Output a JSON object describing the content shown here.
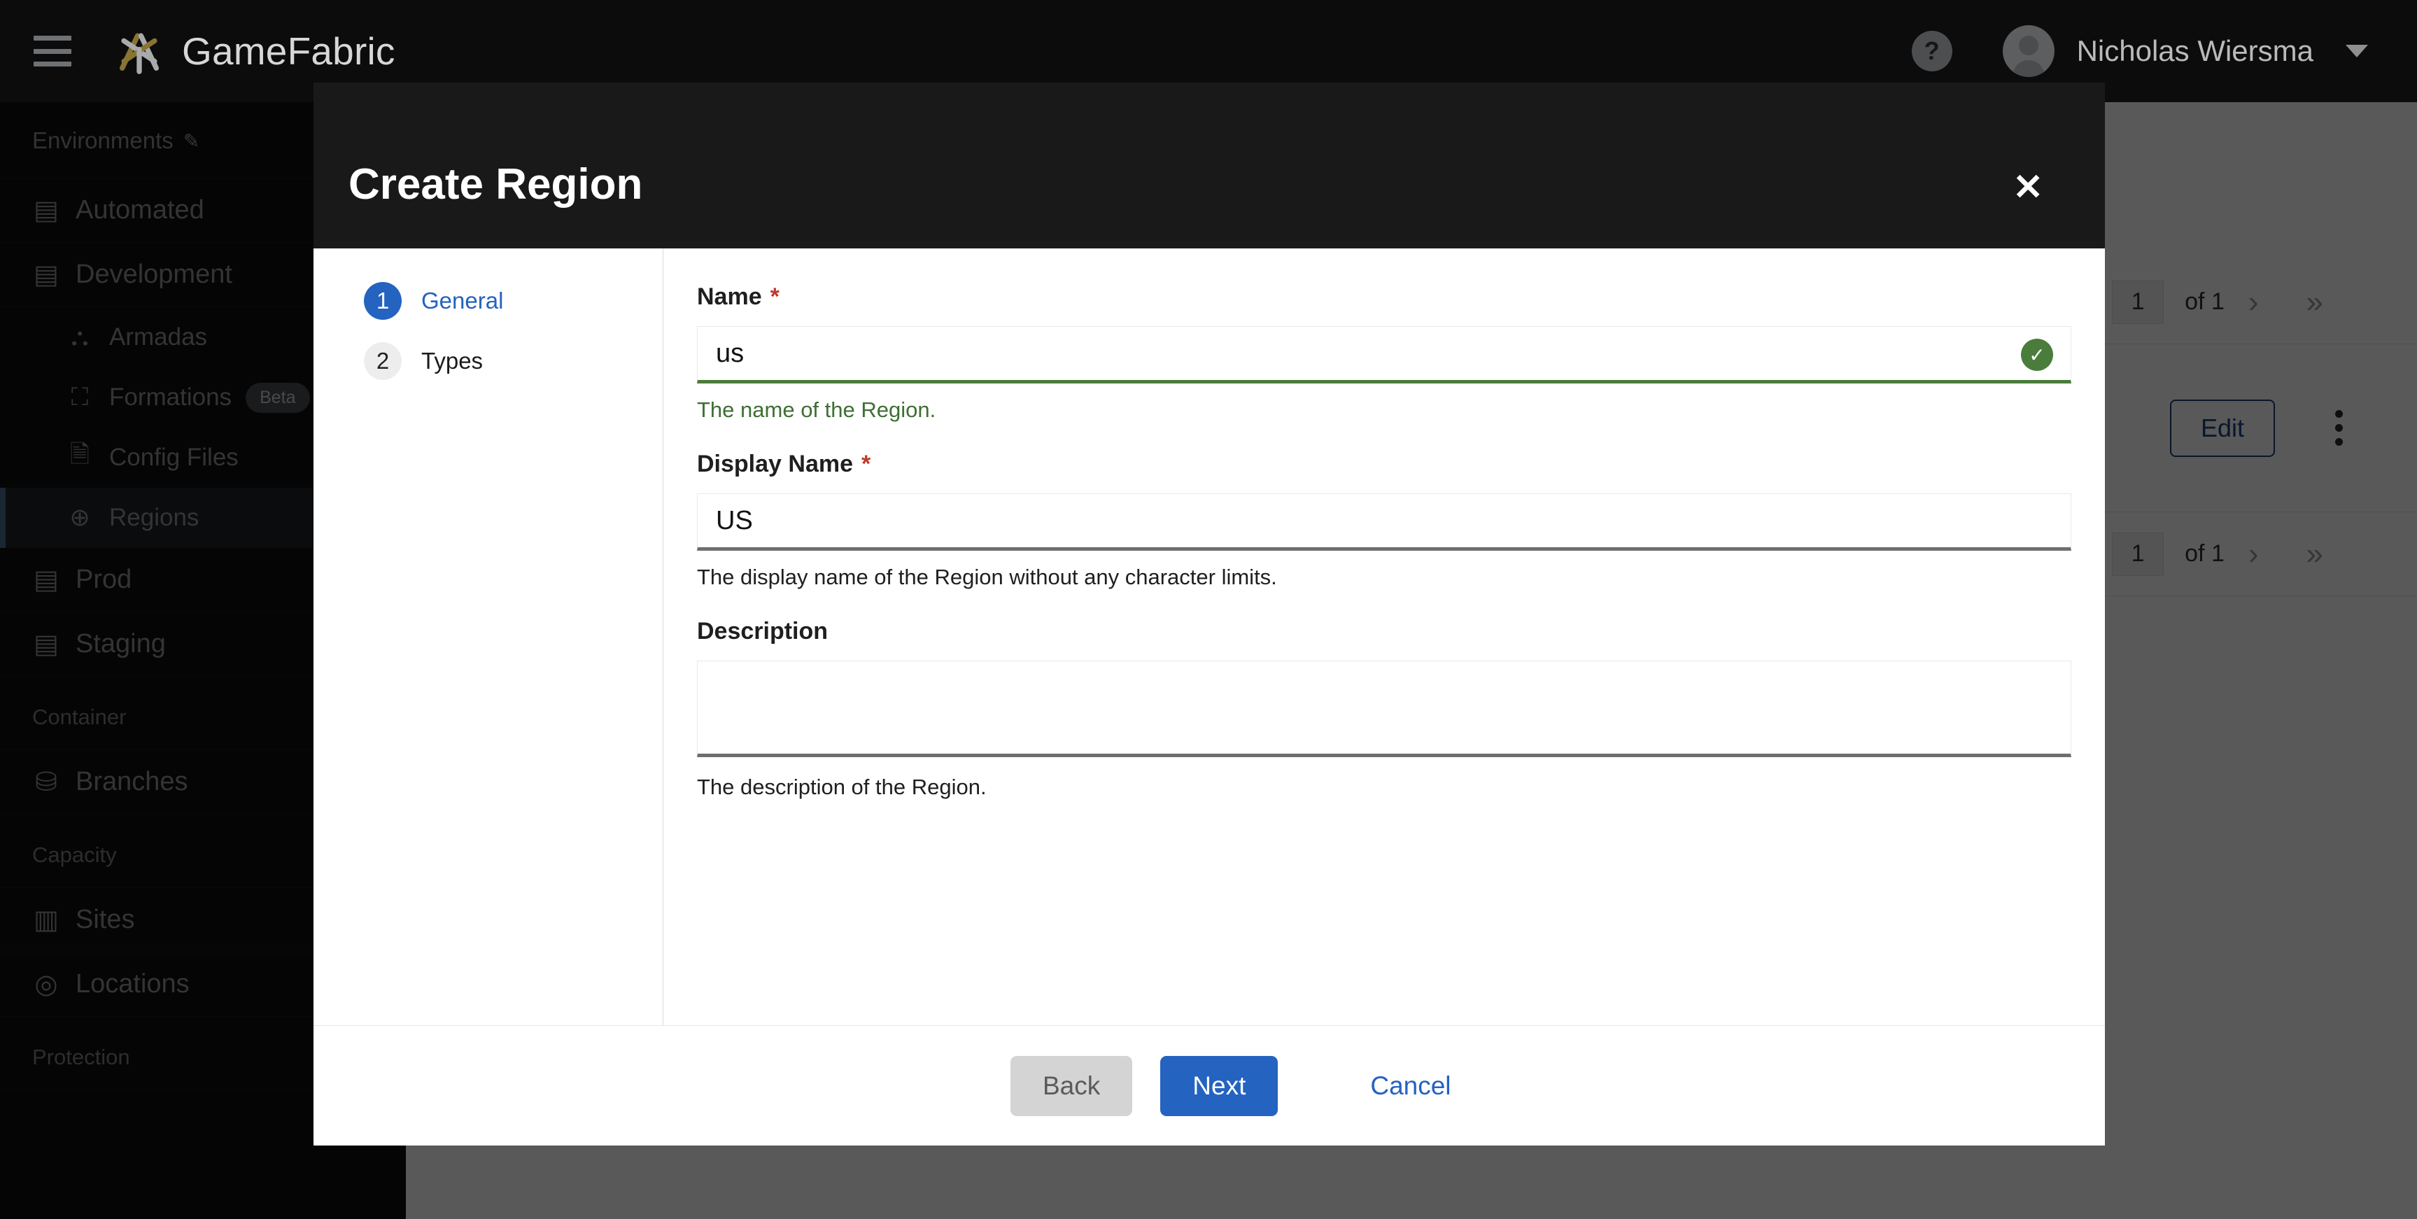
{
  "topbar": {
    "menu_icon": "hamburger-menu-icon",
    "brand_name": "GameFabric",
    "help_icon": "?",
    "username": "Nicholas Wiersma"
  },
  "sidebar": {
    "environments_heading": "Environments",
    "environments_edit_icon": "✎",
    "items": [
      {
        "label": "Automated",
        "icon": "▤",
        "level": "top"
      },
      {
        "label": "Development",
        "icon": "▤",
        "level": "top"
      },
      {
        "label": "Armadas",
        "icon": "⛬",
        "level": "sub"
      },
      {
        "label": "Formations",
        "icon": "⛶",
        "level": "sub",
        "badge": "Beta"
      },
      {
        "label": "Config Files",
        "icon": "🗎",
        "level": "sub"
      },
      {
        "label": "Regions",
        "icon": "⊕",
        "level": "sub",
        "active": true
      },
      {
        "label": "Prod",
        "icon": "▤",
        "level": "top"
      },
      {
        "label": "Staging",
        "icon": "▤",
        "level": "top"
      }
    ],
    "section_container": "Container",
    "branches_label": "Branches",
    "branches_icon": "⛁",
    "section_capacity": "Capacity",
    "sites_label": "Sites",
    "sites_icon": "▥",
    "locations_label": "Locations",
    "locations_icon": "◎",
    "section_protection": "Protection"
  },
  "background": {
    "pager_top": {
      "page": "1",
      "of_label": "of 1",
      "prev_icon": "‹",
      "next_icon": "›",
      "last_icon": "»"
    },
    "edit_button": "Edit",
    "kebab_icon": "kebab-menu-icon",
    "pager_bottom": {
      "page": "1",
      "of_label": "of 1",
      "prev_icon": "‹",
      "next_icon": "›",
      "last_icon": "»"
    }
  },
  "modal": {
    "title": "Create Region",
    "close_icon": "✕",
    "steps": [
      {
        "num": "1",
        "label": "General",
        "active": true
      },
      {
        "num": "2",
        "label": "Types",
        "active": false
      }
    ],
    "fields": {
      "name": {
        "label": "Name",
        "required_marker": "*",
        "value": "us",
        "hint": "The name of the Region.",
        "valid": true,
        "check_icon": "✓"
      },
      "display_name": {
        "label": "Display Name",
        "required_marker": "*",
        "value": "US",
        "hint": "The display name of the Region without any character limits."
      },
      "description": {
        "label": "Description",
        "value": "",
        "hint": "The description of the Region."
      }
    },
    "footer": {
      "back_label": "Back",
      "next_label": "Next",
      "cancel_label": "Cancel"
    }
  },
  "colors": {
    "accent_blue": "#2463c0",
    "valid_green": "#4a7c3c",
    "required_red": "#c0392b",
    "brand_gold": "#8a7432"
  }
}
